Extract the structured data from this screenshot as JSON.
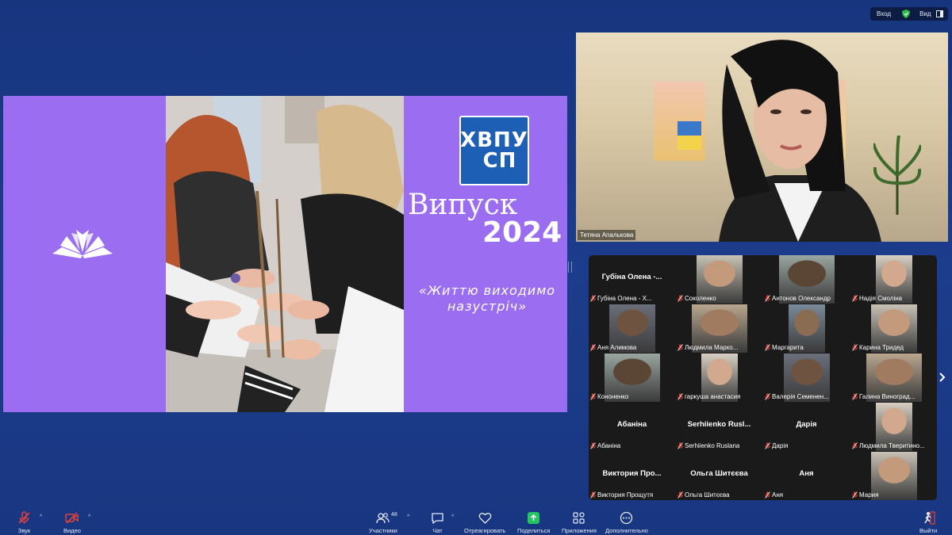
{
  "top_bar": {
    "input_label": "Вход",
    "view_label": "Вид"
  },
  "shared_screen": {
    "badge_line1": "ХВПУ",
    "badge_line2": "СП",
    "title_word": "Випуск",
    "title_year": "2024",
    "quote_line1": "«Життю виходимо",
    "quote_line2": "назустріч»"
  },
  "speaker": {
    "name": "Тетяна Апалькова"
  },
  "gallery": {
    "tiles": [
      {
        "display": "Губіна Олена -...",
        "label": "Губіна Олена - Х...",
        "video": false
      },
      {
        "display": "",
        "label": "Соколенко",
        "video": true
      },
      {
        "display": "",
        "label": "Антонов Олександр",
        "video": true
      },
      {
        "display": "",
        "label": "Надія Смоліна",
        "video": true
      },
      {
        "display": "",
        "label": "Аня Алимова",
        "video": true
      },
      {
        "display": "",
        "label": "Людмила Марко...",
        "video": true
      },
      {
        "display": "",
        "label": "Маргарита",
        "video": true
      },
      {
        "display": "",
        "label": "Карина Тридед",
        "video": true
      },
      {
        "display": "",
        "label": "Кононенко",
        "video": true
      },
      {
        "display": "",
        "label": "гаркуша анастасия",
        "video": true
      },
      {
        "display": "",
        "label": "Валерія Семенен...",
        "video": true
      },
      {
        "display": "",
        "label": "Галина Виноград...",
        "video": true
      },
      {
        "display": "Абаніна",
        "label": "Абаніна",
        "video": false
      },
      {
        "display": "Serhiienko  Rusl...",
        "label": "Serhiienko Ruslana",
        "video": false
      },
      {
        "display": "Дарія",
        "label": "Дарія",
        "video": false
      },
      {
        "display": "",
        "label": "Людмила Тверитино...",
        "video": true
      },
      {
        "display": "Виктория  Про...",
        "label": "Виктория Прощутя",
        "video": false
      },
      {
        "display": "Ольга Шитєєва",
        "label": "Ольга Шитєєва",
        "video": false
      },
      {
        "display": "Аня",
        "label": "Аня",
        "video": false
      },
      {
        "display": "",
        "label": "Мария",
        "video": true
      }
    ]
  },
  "toolbar": {
    "audio": "Звук",
    "video": "Видео",
    "participants": "Участники",
    "participants_count": "48",
    "chat": "Чат",
    "react": "Отреагировать",
    "share": "Поделиться",
    "apps": "Приложения",
    "more": "Дополнительно",
    "leave": "Выйти"
  },
  "colors": {
    "background": "#1a3884",
    "share_bg": "#9b6df0",
    "share_button": "#22c55e",
    "muted": "#e0433a"
  }
}
